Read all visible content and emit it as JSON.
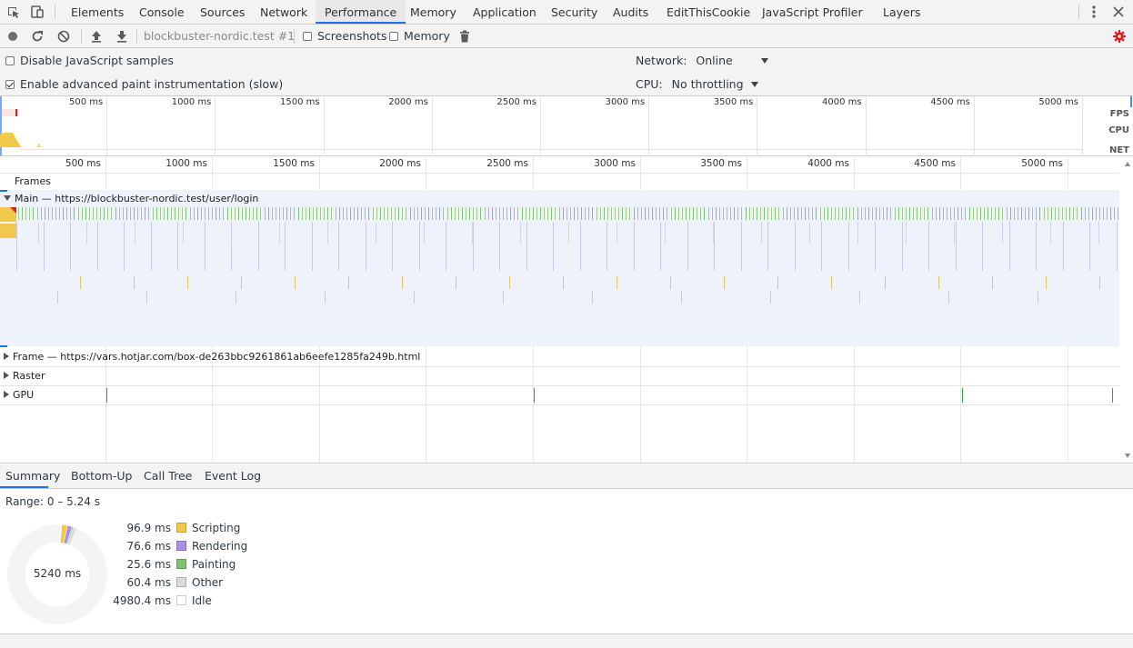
{
  "tabbar": {
    "tabs": [
      {
        "label": "Elements"
      },
      {
        "label": "Console"
      },
      {
        "label": "Sources"
      },
      {
        "label": "Network"
      },
      {
        "label": "Performance"
      },
      {
        "label": "Memory"
      },
      {
        "label": "Application"
      },
      {
        "label": "Security"
      },
      {
        "label": "Audits"
      },
      {
        "label": "EditThisCookie"
      },
      {
        "label": "JavaScript Profiler"
      },
      {
        "label": "Layers"
      }
    ],
    "selected": "Performance"
  },
  "toolbar": {
    "recording_select": "blockbuster-nordic.test #1",
    "screenshots_label": "Screenshots",
    "memory_label": "Memory",
    "screenshots_checked": false,
    "memory_checked": false
  },
  "settings": {
    "disable_js_samples": "Disable JavaScript samples",
    "advanced_paint": "Enable advanced paint instrumentation (slow)",
    "network_label": "Network:",
    "network_value": "Online",
    "cpu_label": "CPU:",
    "cpu_value": "No throttling"
  },
  "overview": {
    "ticks": [
      "500 ms",
      "1000 ms",
      "1500 ms",
      "2000 ms",
      "2500 ms",
      "3000 ms",
      "3500 ms",
      "4000 ms",
      "4500 ms",
      "5000 ms"
    ],
    "lanes": {
      "fps": "FPS",
      "cpu": "CPU",
      "net": "NET"
    }
  },
  "timeline": {
    "ticks": [
      "500 ms",
      "1000 ms",
      "1500 ms",
      "2000 ms",
      "2500 ms",
      "3000 ms",
      "3500 ms",
      "4000 ms",
      "4500 ms",
      "5000 ms"
    ],
    "tracks": {
      "frames": "Frames",
      "main": "Main — https://blockbuster-nordic.test/user/login",
      "frame": "Frame — https://vars.hotjar.com/box-de263bbc9261861ab6eefe1285fa249b.html",
      "raster": "Raster",
      "gpu": "GPU"
    }
  },
  "bottom_tabs": [
    {
      "label": "Summary"
    },
    {
      "label": "Bottom-Up"
    },
    {
      "label": "Call Tree"
    },
    {
      "label": "Event Log"
    }
  ],
  "summary": {
    "range": "Range: 0 – 5.24 s",
    "total": "5240 ms",
    "items": [
      {
        "value": "96.9 ms",
        "label": "Scripting",
        "color": "#f2c94c"
      },
      {
        "value": "76.6 ms",
        "label": "Rendering",
        "color": "#a98ee6"
      },
      {
        "value": "25.6 ms",
        "label": "Painting",
        "color": "#80c275"
      },
      {
        "value": "60.4 ms",
        "label": "Other",
        "color": "#dadada"
      },
      {
        "value": "4980.4 ms",
        "label": "Idle",
        "color": "#ffffff"
      }
    ]
  }
}
